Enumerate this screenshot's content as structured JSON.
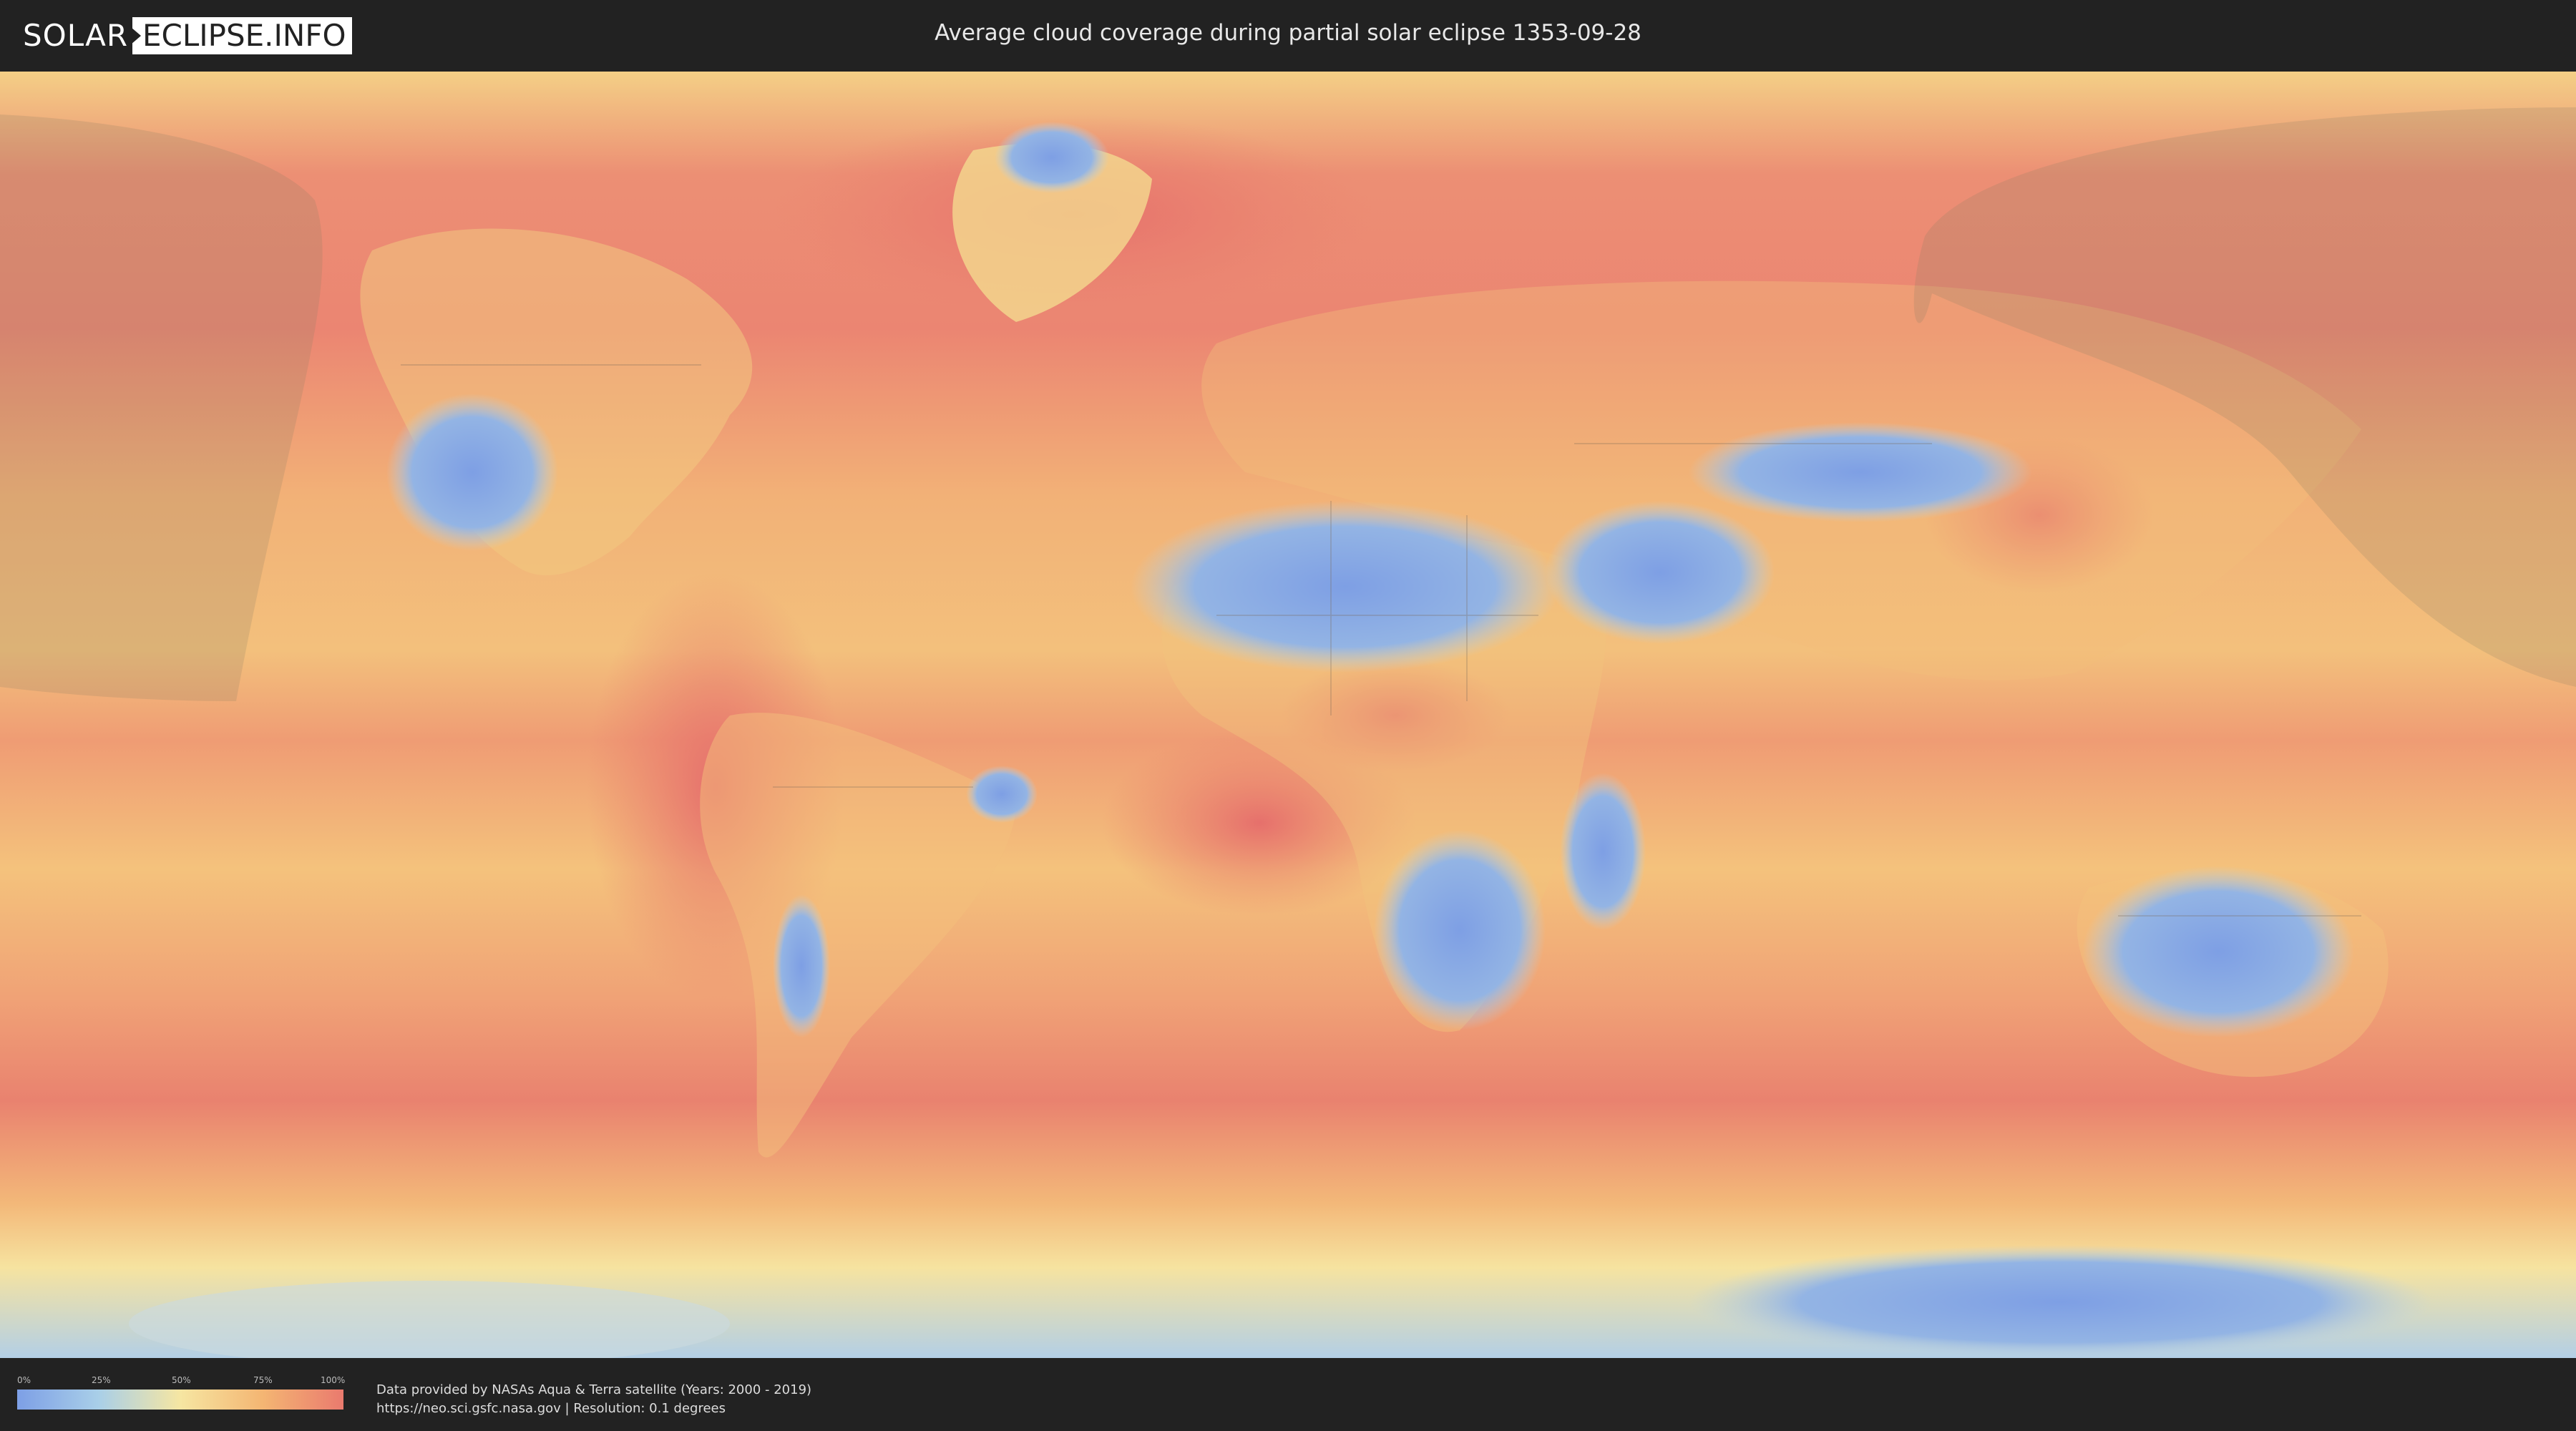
{
  "header": {
    "logo_left": "SOLAR",
    "logo_right": "ECLIPSE.INFO",
    "title": "Average cloud coverage during partial solar eclipse 1353-09-28"
  },
  "map": {
    "description_type": "cloud-coverage world map",
    "colors": {
      "low": "#7d9fe6",
      "mid_low": "#a9cfe8",
      "mid": "#f6e6a2",
      "mid_high": "#f4b673",
      "high": "#ea7a6e",
      "eclipse_overlay": "#8c8064"
    }
  },
  "legend": {
    "ticks": [
      "0%",
      "25%",
      "50%",
      "75%",
      "100%"
    ]
  },
  "credits": {
    "line1": "Data provided by NASAs Aqua & Terra satellite (Years: 2000 - 2019)",
    "line2": "https://neo.sci.gsfc.nasa.gov | Resolution: 0.1 degrees"
  }
}
